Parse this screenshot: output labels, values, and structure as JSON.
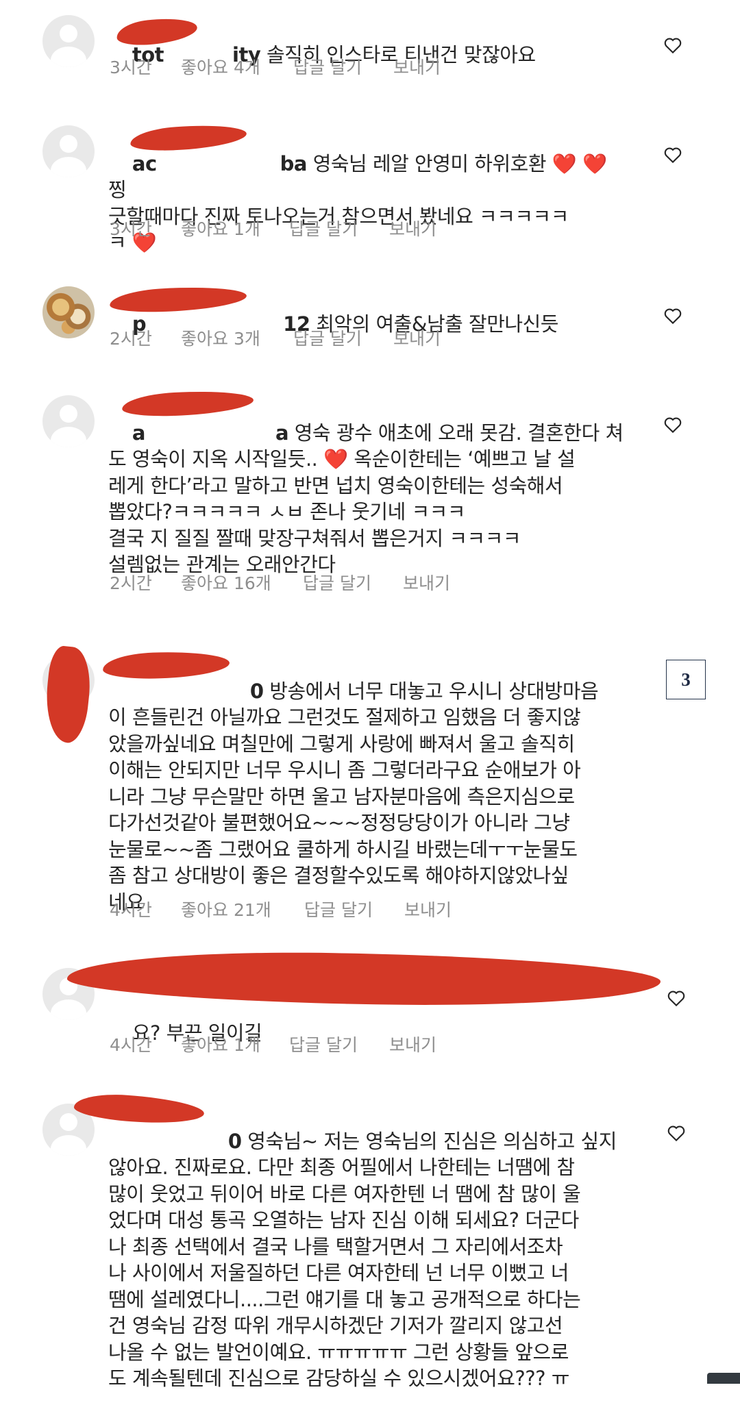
{
  "comments": [
    {
      "username": "tot",
      "username_tail": "ity",
      "text": "솔직히 인스타로 티낸건 맞잖아요",
      "time": "3시간",
      "likes": "좋아요 4개",
      "reply": "답글 달기",
      "send": "보내기",
      "avatar_icon": "default-avatar-icon"
    },
    {
      "username": "ac",
      "username_tail": "ba",
      "text": "영숙님 레알 안영미 하위호환 ❤️ ❤️ 찡\n긋할때마다 진짜 토나오는거 참으면서 봤네요 ㅋㅋㅋㅋㅋ\nㅋ ❤️",
      "time": "3시간",
      "likes": "좋아요 1개",
      "reply": "답글 달기",
      "send": "보내기",
      "avatar_icon": "default-avatar-icon"
    },
    {
      "username": "p",
      "username_tail": "12",
      "text": "최악의 여출&남출 잘만나신듯",
      "time": "2시간",
      "likes": "좋아요 3개",
      "reply": "답글 달기",
      "send": "보내기",
      "avatar_icon": "food-photo-avatar"
    },
    {
      "username": "a",
      "username_tail": "a",
      "text": "영숙 광수 애초에 오래 못감. 결혼한다 쳐\n도 영숙이 지옥 시작일듯.. ❤️ 옥순이한테는 ‘예쁘고 날 설\n레게 한다’라고 말하고 반면 넙치 영숙이한테는 성숙해서\n뽑았다?ㅋㅋㅋㅋㅋ ㅅㅂ 존나 웃기네 ㅋㅋㅋ\n결국 지 질질 짤때 맞장구쳐줘서 뽑은거지 ㅋㅋㅋㅋ\n설렘없는 관계는 오래안간다",
      "time": "2시간",
      "likes": "좋아요 16개",
      "reply": "답글 달기",
      "send": "보내기",
      "avatar_icon": "default-avatar-icon"
    },
    {
      "username": "",
      "username_tail": "0",
      "text": "방송에서 너무 대놓고 우시니 상대방마음\n이 흔들린건 아닐까요 그런것도 절제하고 임했음 더 좋지않\n았을까싶네요 며칠만에 그렇게 사랑에 빠져서 울고 솔직히\n이해는 안되지만 너무 우시니 좀 그렇더라구요 순애보가 아\n니라 그냥 무슨말만 하면 울고 남자분마음에 측은지심으로\n다가선것같아 불편했어요~~~정정당당이가 아니라 그냥\n눈물로~~좀 그랬어요 쿨하게 하시길 바랬는데ㅜㅜ눈물도\n좀 참고 상대방이 좋은 결정할수있도록 해야하지않았나싶\n네요",
      "time": "4시간",
      "likes": "좋아요 21개",
      "reply": "답글 달기",
      "send": "보내기",
      "avatar_icon": "redacted-avatar"
    },
    {
      "username": "",
      "username_tail": "",
      "text": "요? 부끈 일이길",
      "time": "4시간",
      "likes": "좋아요 1개",
      "reply": "답글 달기",
      "send": "보내기",
      "avatar_icon": "default-avatar-icon"
    },
    {
      "username": "",
      "username_tail": "0",
      "text": "영숙님~ 저는 영숙님의 진심은 의심하고 싶지\n않아요. 진짜로요. 다만 최종 어필에서 나한테는 너땜에 참\n많이 웃었고 뒤이어 바로 다른 여자한텐 너 땜에 참 많이 울\n었다며 대성 통곡 오열하는 남자 진심 이해 되세요? 더군다\n나 최종 선택에서 결국 나를 택할거면서 그 자리에서조차\n나 사이에서 저울질하던 다른 여자한테 넌 너무 이뻤고 너\n땜에 설레였다니....그런 얘기를 대 놓고 공개적으로 하다는\n건 영숙님 감정 따위 개무시하겠단 기저가 깔리지 않고선\n나올 수 없는 발언이예요. ㅠㅠㅠㅠㅠ 그런 상황들 앞으로\n도 계속될텐데 진심으로 감당하실 수 있으시겠어요??? ㅠ",
      "avatar_icon": "default-avatar-icon"
    }
  ],
  "page_badge": "3",
  "icons": {
    "like": "heart-outline-icon"
  },
  "colors": {
    "redaction": "#d2321f",
    "meta": "#8e8e8e",
    "text": "#262626"
  }
}
